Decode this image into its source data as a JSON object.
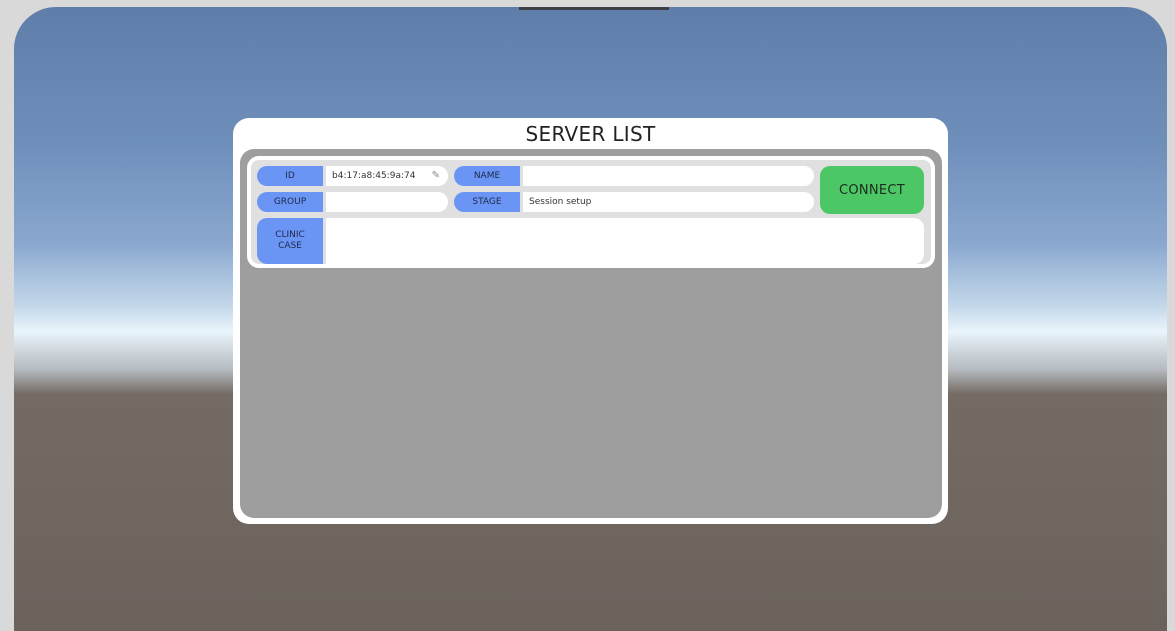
{
  "panel": {
    "title": "SERVER LIST"
  },
  "server": {
    "id_label": "ID",
    "id_value": "b4:17:a8:45:9a:74",
    "name_label": "NAME",
    "name_value": "",
    "group_label": "GROUP",
    "group_value": "",
    "stage_label": "STAGE",
    "stage_value": "Session setup",
    "case_label_line1": "CLINIC",
    "case_label_line2": "CASE",
    "case_value": "",
    "connect_label": "CONNECT"
  },
  "colors": {
    "label_bg": "#6b95f5",
    "connect_bg": "#4dc765",
    "list_bg": "#9e9e9e"
  },
  "icons": {
    "edit": "pencil-icon"
  }
}
